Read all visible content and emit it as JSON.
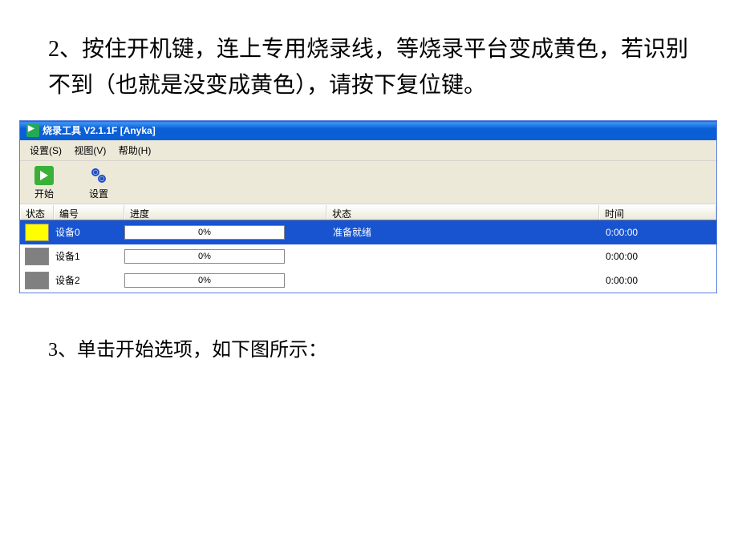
{
  "instruction_top": "2、按住开机键，连上专用烧录线，等烧录平台变成黄色，若识别不到（也就是没变成黄色），请按下复位键。",
  "instruction_bottom": "3、单击开始选项，如下图所示：",
  "window": {
    "title": "烧录工具 V2.1.1F [Anyka]"
  },
  "menu": {
    "settings": "设置(S)",
    "view": "视图(V)",
    "help": "帮助(H)"
  },
  "toolbar": {
    "start": "开始",
    "setup": "设置"
  },
  "headers": {
    "status": "状态",
    "number": "编号",
    "progress": "进度",
    "status2": "状态",
    "time": "时间"
  },
  "devices": [
    {
      "name": "设备0",
      "progress": "0%",
      "status": "准备就绪",
      "time": "0:00:00",
      "color": "yellow",
      "selected": true
    },
    {
      "name": "设备1",
      "progress": "0%",
      "status": "",
      "time": "0:00:00",
      "color": "gray",
      "selected": false
    },
    {
      "name": "设备2",
      "progress": "0%",
      "status": "",
      "time": "0:00:00",
      "color": "gray",
      "selected": false
    }
  ]
}
